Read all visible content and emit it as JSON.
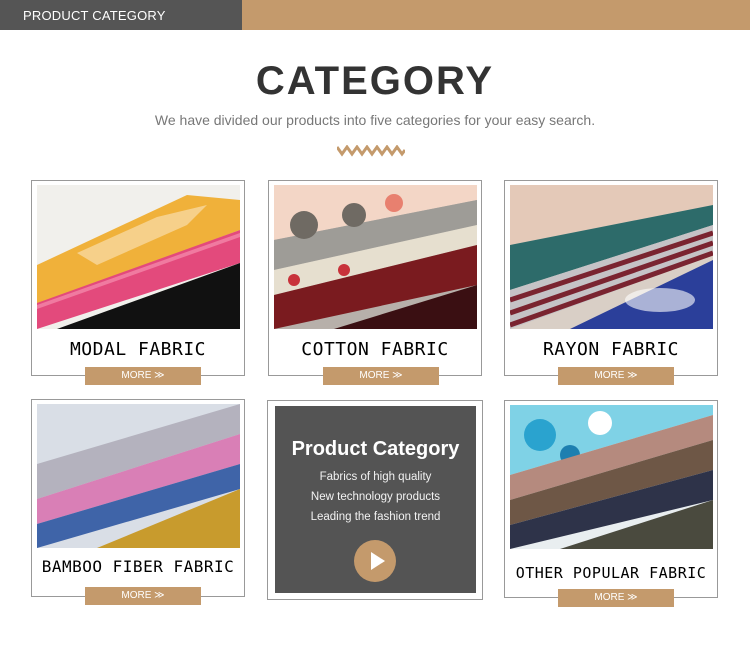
{
  "topbar": {
    "tab_label": "PRODUCT CATEGORY"
  },
  "header": {
    "title": "CATEGORY",
    "subtitle": "We have divided our products into five categories for your easy search."
  },
  "cards": [
    {
      "label": "MODAL FABRIC",
      "more": "MORE ≫"
    },
    {
      "label": "COTTON FABRIC",
      "more": "MORE ≫"
    },
    {
      "label": "RAYON FABRIC",
      "more": "MORE ≫"
    },
    {
      "label": "BAMBOO FIBER FABRIC",
      "more": "MORE ≫"
    },
    {
      "label": "OTHER POPULAR FABRIC",
      "more": "MORE ≫"
    }
  ],
  "promo": {
    "title": "Product Category",
    "lines": [
      "Fabrics of high quality",
      "New technology products",
      "Leading the fashion trend"
    ],
    "play_icon": "play-icon"
  },
  "colors": {
    "accent": "#c49a6c",
    "tab": "#555555",
    "promo_bg": "#545454"
  }
}
